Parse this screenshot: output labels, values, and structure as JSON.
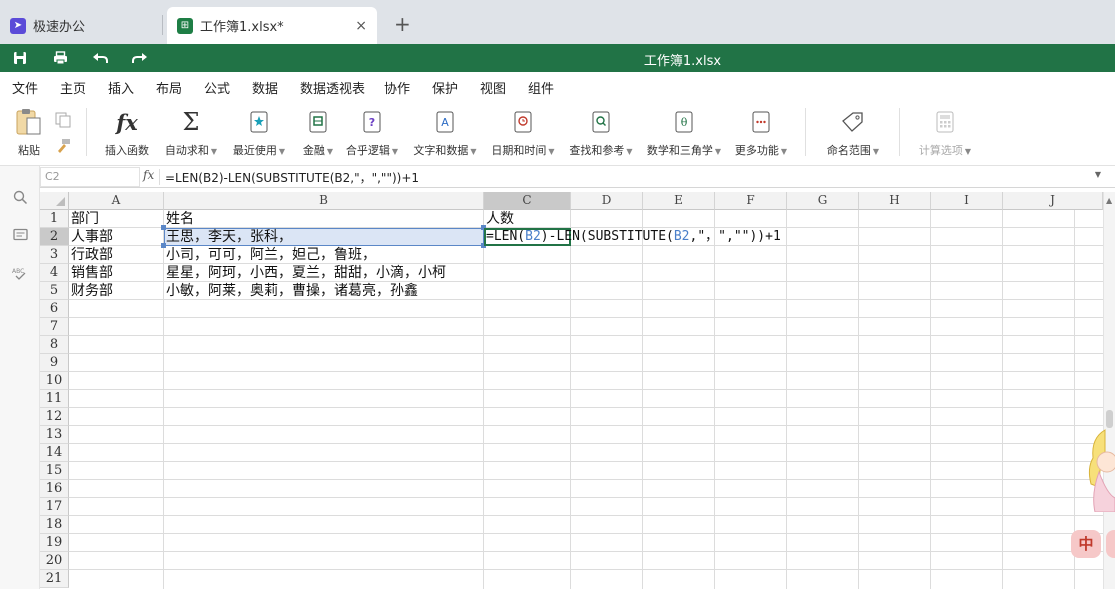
{
  "tabs": [
    {
      "label": "极速办公",
      "icon": "rocket-icon",
      "color": "#5b4bd8"
    },
    {
      "label": "工作簿1.xlsx*",
      "icon": "spreadsheet-icon",
      "color": "#1e7e45",
      "close": "×"
    }
  ],
  "new_tab": "+",
  "titlebar": {
    "title": "工作簿1.xlsx",
    "bg": "#217346"
  },
  "menu": [
    "文件",
    "主页",
    "插入",
    "布局",
    "公式",
    "数据",
    "数据透视表",
    "协作",
    "保护",
    "视图",
    "组件"
  ],
  "menu_active": "公式",
  "ribbon": {
    "paste": "粘贴",
    "insert_function": "插入函数",
    "autosum": "自动求和",
    "recent": "最近使用",
    "financial": "金融",
    "logical": "合乎逻辑",
    "text": "文字和数据",
    "datetime": "日期和时间",
    "lookup": "查找和参考",
    "math": "数学和三角学",
    "more": "更多功能",
    "named_range": "命名范围",
    "calc_options": "计算选项"
  },
  "formula_bar": {
    "name_box": "C2",
    "fx": "fx",
    "formula": "=LEN(B2)-LEN(SUBSTITUTE(B2,\"，\",\"\"))+1"
  },
  "columns": [
    "A",
    "B",
    "C",
    "D",
    "E",
    "F",
    "G",
    "H",
    "I",
    "J"
  ],
  "selected_column": "C",
  "rows": [
    "1",
    "2",
    "3",
    "4",
    "5",
    "6",
    "7",
    "8",
    "9",
    "10",
    "11",
    "12",
    "13",
    "14",
    "15",
    "16",
    "17",
    "18",
    "19",
    "20",
    "21"
  ],
  "selected_row": "2",
  "cells": {
    "A1": "部门",
    "B1": "姓名",
    "C1": "人数",
    "A2": "人事部",
    "B2": "王思，李天，张科，",
    "A3": "行政部",
    "B3": "小司，可可，阿兰，妲己，鲁班，",
    "A4": "销售部",
    "B4": "星星，阿珂，小西，夏兰，甜甜，小滴，小柯",
    "A5": "财务部",
    "B5": "小敏，阿莱，奥莉，曹操，诸葛亮，孙鑫"
  },
  "c2_edit": {
    "p1": "=LEN(",
    "r1": "B2",
    "p2": ")-LEN(SUBSTITUTE(",
    "r2": "B2",
    "p3": ",\"，\",\"\"))+1"
  },
  "ime_label": "中"
}
